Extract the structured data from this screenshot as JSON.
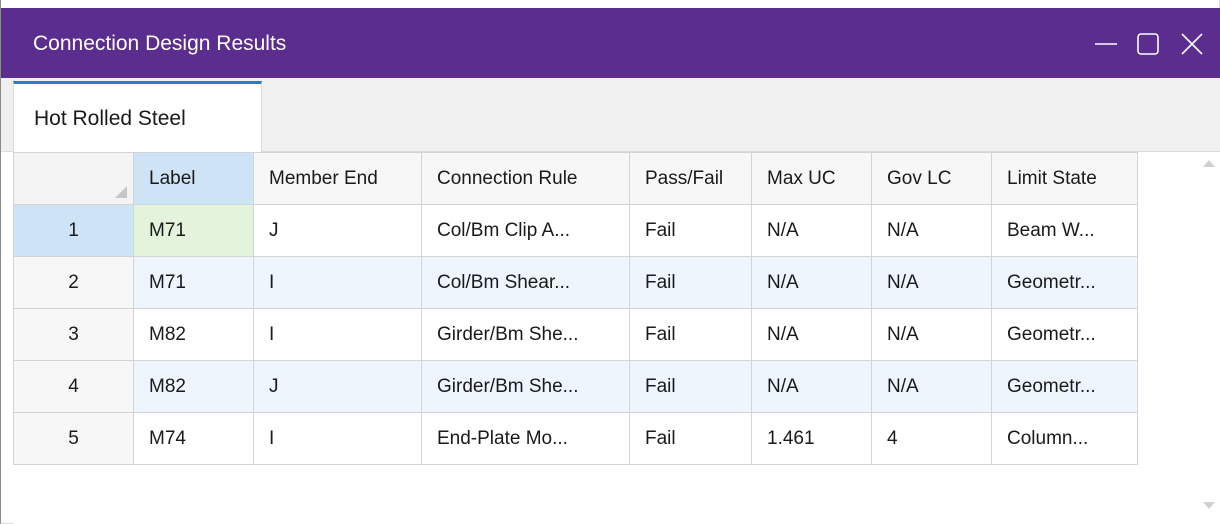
{
  "window": {
    "title": "Connection Design Results",
    "accent_color": "#5b2d8e",
    "controls": [
      "minimize-icon",
      "maximize-icon",
      "close-icon"
    ]
  },
  "tabs": [
    {
      "label": "Hot Rolled Steel",
      "active": true
    }
  ],
  "table": {
    "columns": [
      "Label",
      "Member End",
      "Connection Rule",
      "Pass/Fail",
      "Max UC",
      "Gov LC",
      "Limit State"
    ],
    "rows": [
      {
        "num": "1",
        "cells": [
          "M71",
          "J",
          "Col/Bm Clip A...",
          "Fail",
          "N/A",
          "N/A",
          "Beam W..."
        ]
      },
      {
        "num": "2",
        "cells": [
          "M71",
          "I",
          "Col/Bm Shear...",
          "Fail",
          "N/A",
          "N/A",
          "Geometr..."
        ]
      },
      {
        "num": "3",
        "cells": [
          "M82",
          "I",
          "Girder/Bm She...",
          "Fail",
          "N/A",
          "N/A",
          "Geometr..."
        ]
      },
      {
        "num": "4",
        "cells": [
          "M82",
          "J",
          "Girder/Bm She...",
          "Fail",
          "N/A",
          "N/A",
          "Geometr..."
        ]
      },
      {
        "num": "5",
        "cells": [
          "M74",
          "I",
          "End-Plate Mo...",
          "Fail",
          "1.461",
          "4",
          "Column..."
        ]
      }
    ]
  }
}
